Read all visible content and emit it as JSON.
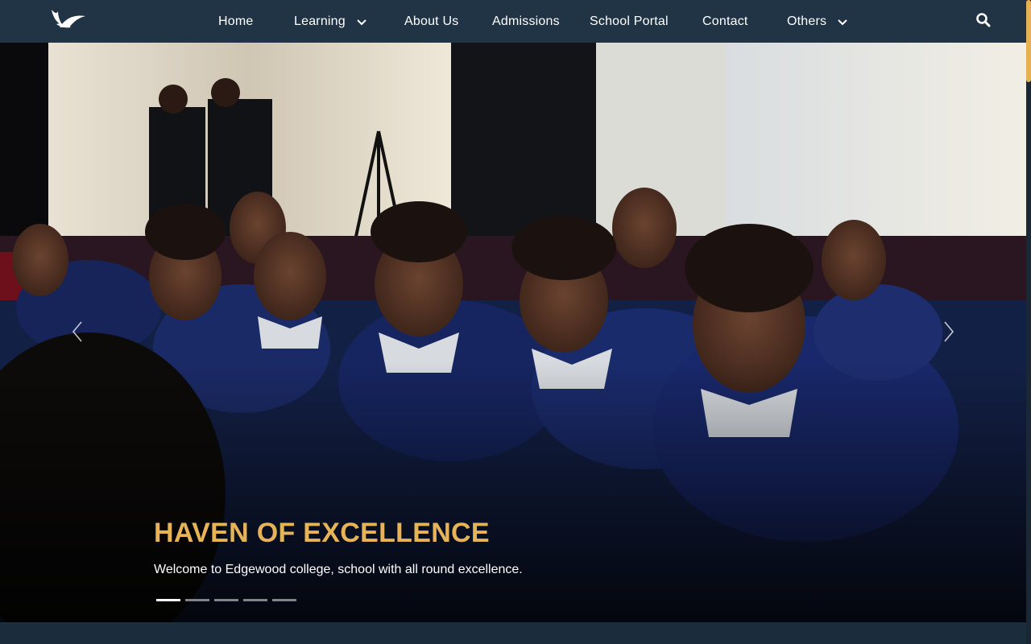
{
  "nav": {
    "logo_icon": "dove-wing-logo",
    "items": [
      {
        "label": "Home",
        "has_dropdown": false
      },
      {
        "label": "Learning",
        "has_dropdown": true
      },
      {
        "label": "About Us",
        "has_dropdown": false
      },
      {
        "label": "Admissions",
        "has_dropdown": false
      },
      {
        "label": "School Portal",
        "has_dropdown": false
      },
      {
        "label": "Contact",
        "has_dropdown": false
      },
      {
        "label": "Others",
        "has_dropdown": true
      }
    ],
    "search_icon": "search-icon",
    "background": "#213446"
  },
  "hero": {
    "title": "HAVEN OF EXCELLENCE",
    "subtitle": "Welcome to Edgewood college, school with all round excellence.",
    "slide_count": 5,
    "active_slide": 1,
    "title_color": "#e6b357"
  },
  "colors": {
    "accent": "#e3b253",
    "page_bg": "#1b2b3b"
  }
}
